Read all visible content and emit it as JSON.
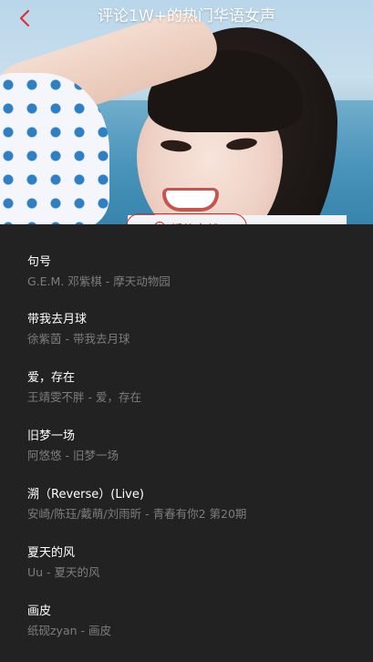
{
  "header": {
    "title": "评论1W+的热门华语女声",
    "back_icon": "chevron-left-icon",
    "back_color": "#e0303a"
  },
  "play_button": {
    "label": "播放全部"
  },
  "songs": [
    {
      "title": "句号",
      "subtitle": "G.E.M. 邓紫棋 - 摩天动物园"
    },
    {
      "title": "带我去月球",
      "subtitle": "徐紫茵 - 带我去月球"
    },
    {
      "title": "爱，存在",
      "subtitle": "王靖雯不胖 - 爱，存在"
    },
    {
      "title": "旧梦一场",
      "subtitle": "阿悠悠 - 旧梦一场"
    },
    {
      "title": "溯（Reverse）(Live)",
      "subtitle": "安崎/陈珏/戴萌/刘雨昕 - 青春有你2 第20期"
    },
    {
      "title": "夏天的风",
      "subtitle": "Uu - 夏天的风"
    },
    {
      "title": "画皮",
      "subtitle": "纸砚zyan - 画皮"
    }
  ],
  "colors": {
    "accent": "#d22a2a",
    "background": "#222222",
    "title_text": "#ffffff",
    "sub_text": "#7d7d7d"
  }
}
